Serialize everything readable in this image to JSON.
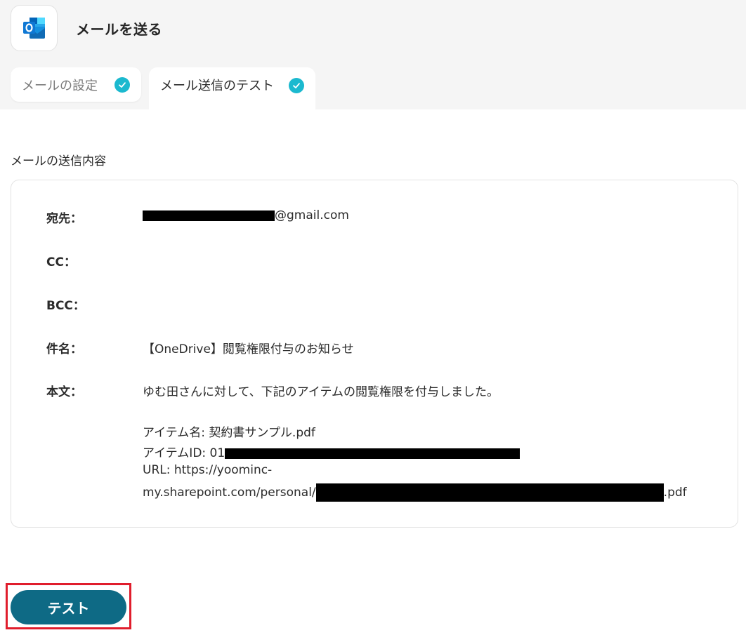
{
  "header": {
    "title": "メールを送る",
    "app_icon": "outlook-icon"
  },
  "tabs": [
    {
      "label": "メールの設定",
      "completed": true
    },
    {
      "label": "メール送信のテスト",
      "completed": true,
      "active": true
    }
  ],
  "section": {
    "title": "メールの送信内容"
  },
  "email": {
    "to_label": "宛先：",
    "to_value_suffix": "@gmail.com",
    "cc_label": "CC：",
    "bcc_label": "BCC：",
    "subject_label": "件名：",
    "subject_value": "【OneDrive】閲覧権限付与のお知らせ",
    "body_label": "本文：",
    "body_line1": "ゆむ田さんに対して、下記のアイテムの閲覧権限を付与しました。",
    "body_item_name": "アイテム名: 契約書サンプル.pdf",
    "body_item_id_prefix": "アイテムID: 01",
    "body_url_line1": "URL: https://yoominc-",
    "body_url_line2_prefix": "my.sharepoint.com/personal/",
    "body_url_line2_suffix": ".pdf"
  },
  "actions": {
    "test_button": "テスト"
  },
  "colors": {
    "check": "#1bb9cf",
    "button": "#0e6a85",
    "highlight": "#e01d2c"
  }
}
